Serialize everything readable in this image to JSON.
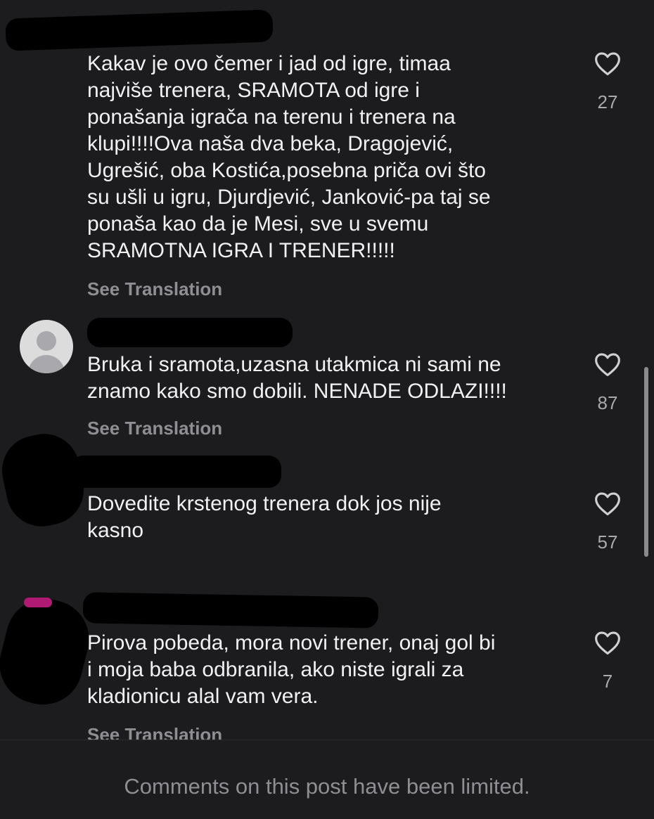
{
  "comments": [
    {
      "text": "Kakav je ovo čemer i jad od igre, timaa\nnajviše trenera, SRAMOTA od igre i\nponašanja igrača na terenu i trenera na\nklupi!!!!Ova naša dva beka, Dragojević,\nUgrešić, oba Kostića,posebna priča ovi što\nsu ušli u igru, Djurdjević, Janković-pa taj se\nponaša kao da je Mesi, sve u svemu\nSRAMOTNA IGRA I TRENER!!!!!",
      "likes": "27",
      "translation": "See Translation"
    },
    {
      "text": "Bruka i sramota,uzasna utakmica ni sami ne\nznamo kako smo dobili. NENADE ODLAZI!!!!",
      "likes": "87",
      "translation": "See Translation"
    },
    {
      "text": "Dovedite krstenog trenera dok jos nije\nkasno",
      "likes": "57"
    },
    {
      "text": "Pirova pobeda, mora novi trener, onaj gol bi\ni moja baba odbranila, ako niste igrali za\nkladionicu alal vam vera.",
      "likes": "7",
      "translation": "See Translation"
    }
  ],
  "footer": {
    "notice": "Comments on this post have been limited."
  },
  "icons": {
    "like": "heart-outline-icon",
    "avatar": "default-avatar-icon"
  },
  "colors": {
    "background": "#1c1c1f",
    "text": "#f1f1f1",
    "muted": "#8e8e93"
  }
}
